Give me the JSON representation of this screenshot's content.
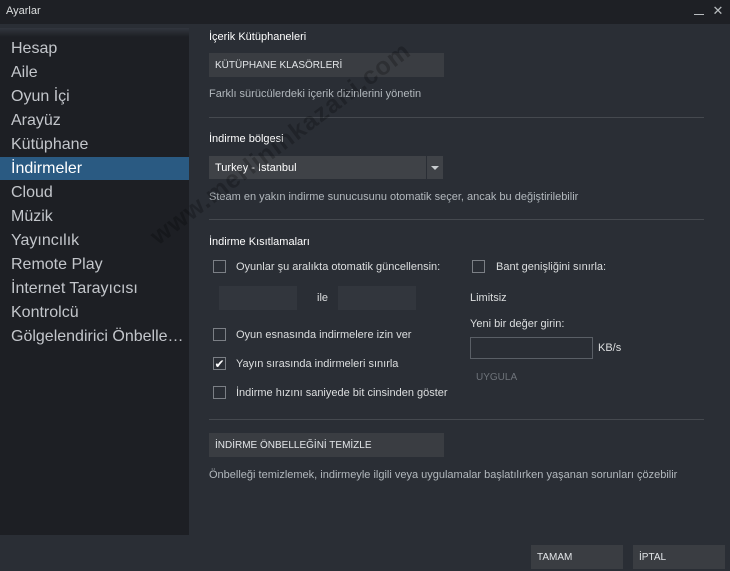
{
  "window": {
    "title": "Ayarlar",
    "minimize_glyph": "",
    "close_glyph": "✕"
  },
  "sidebar": {
    "items": [
      {
        "label": "Hesap"
      },
      {
        "label": "Aile"
      },
      {
        "label": "Oyun İçi"
      },
      {
        "label": "Arayüz"
      },
      {
        "label": "Kütüphane"
      },
      {
        "label": "İndirmeler",
        "active": true
      },
      {
        "label": "Cloud"
      },
      {
        "label": "Müzik"
      },
      {
        "label": "Yayıncılık"
      },
      {
        "label": "Remote Play"
      },
      {
        "label": "İnternet Tarayıcısı"
      },
      {
        "label": "Kontrolcü"
      },
      {
        "label": "Gölgelendirici Önbellekleme"
      }
    ]
  },
  "content_libraries": {
    "title": "İçerik Kütüphaneleri",
    "button": "KÜTÜPHANE KLASÖRLERİ",
    "description": "Farklı sürücülerdeki içerik dizinlerini yönetin"
  },
  "download_region": {
    "title": "İndirme bölgesi",
    "selected": "Turkey - Istanbul",
    "description": "Steam en yakın indirme sunucusunu otomatik seçer, ancak bu değiştirilebilir"
  },
  "download_restrictions": {
    "title": "İndirme Kısıtlamaları",
    "auto_update": {
      "label": "Oyunlar şu aralıkta otomatik güncellensin:",
      "checked": false
    },
    "range_connector": "ile",
    "allow_ingame": {
      "label": "Oyun esnasında indirmelere izin ver",
      "checked": false
    },
    "throttle_streaming": {
      "label": "Yayın sırasında indirmeleri sınırla",
      "checked": true
    },
    "show_bits": {
      "label": "İndirme hızını saniyede bit cinsinden göster",
      "checked": false
    },
    "limit_bandwidth": {
      "label": "Bant genişliğini sınırla:",
      "checked": false
    },
    "limit_status": "Limitsiz",
    "new_value_label": "Yeni bir değer girin:",
    "unit": "KB/s",
    "apply_button": "UYGULA"
  },
  "cache": {
    "button": "İNDİRME ÖNBELLEĞİNİ TEMİZLE",
    "description": "Önbelleği temizlemek, indirmeyle ilgili veya uygulamalar başlatılırken yaşanan sorunları çözebilir"
  },
  "footer": {
    "ok": "TAMAM",
    "cancel": "İPTAL"
  },
  "watermark": "www.merlininkazani.com",
  "checkmark_glyph": "✔",
  "colors": {
    "accent": "#2a5a82",
    "background": "#2a2e35",
    "sidebar": "#1d1f24"
  }
}
